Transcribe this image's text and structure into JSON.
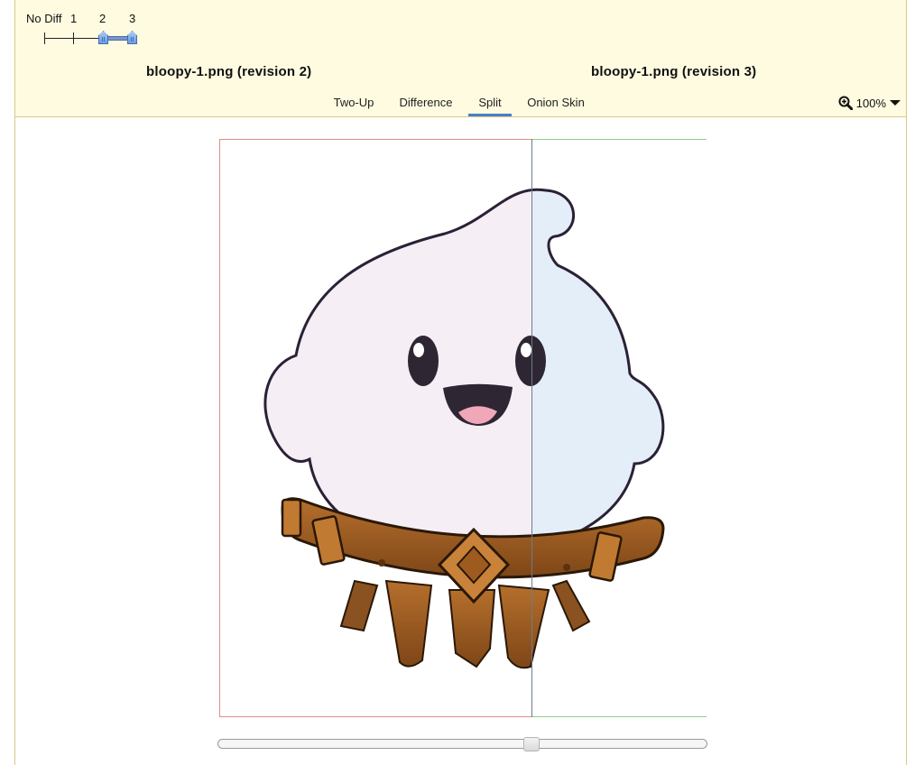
{
  "revisions": {
    "labels": [
      "No Diff",
      "1",
      "2",
      "3"
    ],
    "selected_from": "2",
    "selected_to": "3"
  },
  "files": {
    "left_title": "bloopy-1.png (revision 2)",
    "right_title": "bloopy-1.png (revision 3)"
  },
  "tabs": [
    {
      "label": "Two-Up",
      "active": false
    },
    {
      "label": "Difference",
      "active": false
    },
    {
      "label": "Split",
      "active": true
    },
    {
      "label": "Onion Skin",
      "active": false
    }
  ],
  "zoom": {
    "value": "100%",
    "icon": "zoom-in-icon",
    "dropdown_icon": "caret-down-icon"
  },
  "split": {
    "position_fraction": 0.64
  },
  "colors": {
    "header_bg": "#fefbe0",
    "old_border": "#e48a8a",
    "new_border": "#8ccf8c",
    "active_tab": "#4a80c4"
  }
}
